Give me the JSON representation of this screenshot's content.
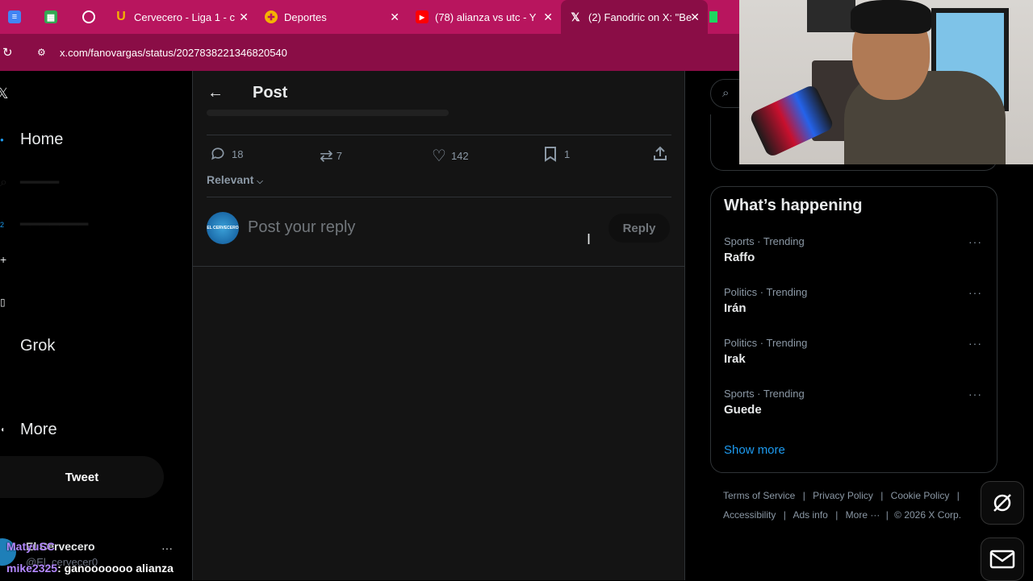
{
  "browser": {
    "tabs": [
      {
        "label": "",
        "icon": "docs-icon"
      },
      {
        "label": "",
        "icon": "sheets-icon"
      },
      {
        "label": "",
        "icon": "whatsapp-icon"
      },
      {
        "label": "Cervecero - Liga 1 - c",
        "icon": "u-logo-icon"
      },
      {
        "label": "Deportes",
        "icon": "deportes-icon"
      },
      {
        "label": "(78) alianza vs utc - Y",
        "icon": "youtube-icon"
      },
      {
        "label": "(2) Fanodric on X: \"Be",
        "icon": "x-logo-icon"
      }
    ],
    "url": "x.com/fanovargas/status/2027838221346820540"
  },
  "nav": {
    "items": [
      "Home",
      "Grok",
      "More"
    ],
    "tweet_label": "Tweet",
    "account_name": "El Cervecero",
    "account_handle": "@El_cervecer0"
  },
  "chat_overlay": {
    "line1": "MatyuSC",
    "user2": "mike2325",
    "msg2": ": ganooooooo alianza"
  },
  "post": {
    "header_title": "Post",
    "replies": "18",
    "reposts": "7",
    "likes": "142",
    "bookmarks": "1",
    "sort_label": "Relevant",
    "reply_placeholder": "Post your reply",
    "reply_button": "Reply",
    "avatar_text": "EL CERVECERO"
  },
  "trending": {
    "title": "What’s happening",
    "items": [
      {
        "meta": "Sports · Trending",
        "name": "Raffo"
      },
      {
        "meta": "Politics · Trending",
        "name": "Irán"
      },
      {
        "meta": "Politics · Trending",
        "name": "Irak"
      },
      {
        "meta": "Sports · Trending",
        "name": "Guede"
      }
    ],
    "show_more": "Show more"
  },
  "footer": {
    "terms": "Terms of Service",
    "privacy": "Privacy Policy",
    "cookie": "Cookie Policy",
    "accessibility": "Accessibility",
    "ads": "Ads info",
    "more": "More ···",
    "copyright": "© 2026 X Corp."
  },
  "colors": {
    "tabbar": "#b8155e",
    "link": "#1d9bf0",
    "bg": "#000000"
  }
}
